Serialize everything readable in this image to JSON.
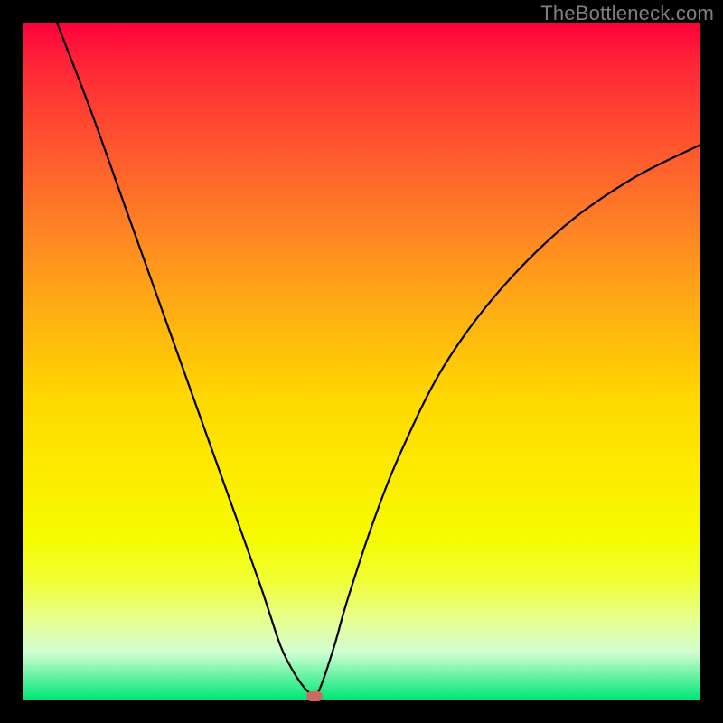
{
  "watermark": "TheBottleneck.com",
  "colors": {
    "background": "#000000",
    "gradient_top": "#ff003b",
    "gradient_bottom": "#00e676",
    "curve": "#000000",
    "marker": "#cc6a66",
    "watermark_text": "#808080"
  },
  "chart_data": {
    "type": "line",
    "title": "",
    "xlabel": "",
    "ylabel": "",
    "xlim": [
      0,
      100
    ],
    "ylim": [
      0,
      100
    ],
    "grid": false,
    "legend": false,
    "annotations": [],
    "curve_left": {
      "x": [
        5,
        10,
        15,
        20,
        25,
        30,
        35,
        38,
        40,
        41.5,
        42.5,
        43
      ],
      "y": [
        100,
        87,
        73,
        59,
        45,
        31,
        17,
        8,
        4,
        1.8,
        0.8,
        0.3
      ]
    },
    "curve_right": {
      "x": [
        43,
        44,
        46,
        48,
        52,
        56,
        62,
        70,
        80,
        90,
        100
      ],
      "y": [
        0.3,
        2,
        8,
        15,
        27,
        37,
        49,
        60,
        70,
        77,
        82
      ]
    },
    "minimum_point": {
      "x": 43,
      "y": 0.3
    },
    "marker": {
      "x": 43,
      "y": 0.5
    }
  }
}
